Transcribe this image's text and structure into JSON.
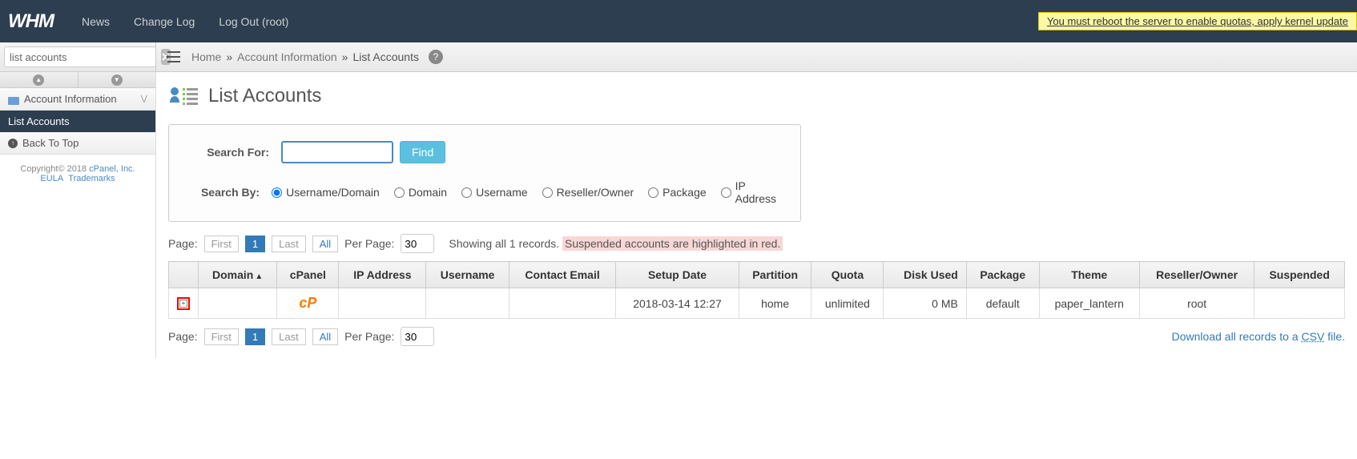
{
  "top_nav": {
    "logo": "WHM",
    "links": {
      "news": "News",
      "change_log": "Change Log",
      "log_out": "Log Out (root)"
    },
    "notification": "You must reboot the server to enable quotas, apply kernel update"
  },
  "sidebar_search": {
    "value": "list accounts"
  },
  "breadcrumb": {
    "home": "Home",
    "section": "Account Information",
    "page": "List Accounts"
  },
  "sidebar": {
    "section": "Account Information",
    "active_item": "List Accounts",
    "back": "Back To Top",
    "copyright": "Copyright© 2018 ",
    "cpanel_link": "cPanel, Inc.",
    "eula": "EULA",
    "trademarks": "Trademarks"
  },
  "page": {
    "title": "List Accounts"
  },
  "search_panel": {
    "search_for_label": "Search For:",
    "find_button": "Find",
    "search_by_label": "Search By:",
    "radios": {
      "username_domain": "Username/Domain",
      "domain": "Domain",
      "username": "Username",
      "reseller_owner": "Reseller/Owner",
      "package": "Package",
      "ip_address": "IP Address"
    }
  },
  "pagination": {
    "page_label": "Page:",
    "first": "First",
    "page_num": "1",
    "last": "Last",
    "all": "All",
    "per_page_label": "Per Page:",
    "per_page_value": "30",
    "showing": "Showing all 1 records.",
    "suspended_note": "Suspended accounts are highlighted in red."
  },
  "table": {
    "headers": {
      "domain": "Domain",
      "cpanel": "cPanel",
      "ip_address": "IP Address",
      "username": "Username",
      "contact_email": "Contact Email",
      "setup_date": "Setup Date",
      "partition": "Partition",
      "quota": "Quota",
      "disk_used": "Disk Used",
      "package": "Package",
      "theme": "Theme",
      "reseller_owner": "Reseller/Owner",
      "suspended": "Suspended"
    },
    "rows": [
      {
        "domain": "",
        "ip_address": "",
        "username": "",
        "contact_email": "",
        "setup_date": "2018-03-14 12:27",
        "partition": "home",
        "quota": "unlimited",
        "disk_used": "0 MB",
        "package": "default",
        "theme": "paper_lantern",
        "reseller_owner": "root",
        "suspended": ""
      }
    ]
  },
  "download": {
    "prefix": "Download all records to a ",
    "csv": "CSV",
    "suffix": " file."
  }
}
